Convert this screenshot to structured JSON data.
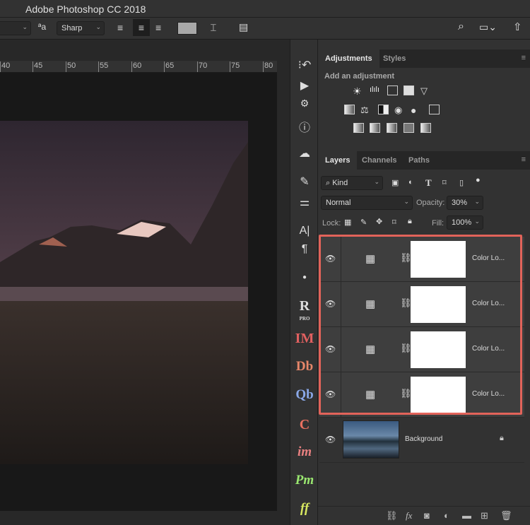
{
  "app": {
    "title": "Adobe Photoshop CC 2018"
  },
  "options": {
    "antialias_icon": "aa-icon",
    "antialias": "Sharp",
    "align_left": "align-left-icon",
    "align_center": "align-center-icon",
    "align_right": "align-right-icon",
    "color_swatch": "#a8a8a8"
  },
  "ruler": {
    "ticks": [
      "40",
      "45",
      "50",
      "55",
      "60",
      "65",
      "70",
      "75",
      "80"
    ]
  },
  "dock": {
    "plugins": [
      "R",
      "IM",
      "Db",
      "Qb",
      "C",
      "im",
      "Pm",
      "ff"
    ],
    "pro_label": "PRO"
  },
  "adjustments": {
    "tabs": [
      "Adjustments",
      "Styles"
    ],
    "subtitle": "Add an adjustment"
  },
  "layers_panel": {
    "tabs": [
      "Layers",
      "Channels",
      "Paths"
    ],
    "filter": "Kind",
    "blend_mode": "Normal",
    "opacity_label": "Opacity:",
    "opacity": "30%",
    "lock_label": "Lock:",
    "fill_label": "Fill:",
    "fill": "100%",
    "layers": [
      {
        "name": "Color Lo...",
        "visible": true,
        "selected": true
      },
      {
        "name": "Color Lo...",
        "visible": true,
        "selected": true
      },
      {
        "name": "Color Lo...",
        "visible": true,
        "selected": true
      },
      {
        "name": "Color Lo...",
        "visible": true,
        "selected": true
      },
      {
        "name": "Background",
        "visible": true,
        "locked": true
      }
    ],
    "highlight_color": "#e2635a"
  }
}
